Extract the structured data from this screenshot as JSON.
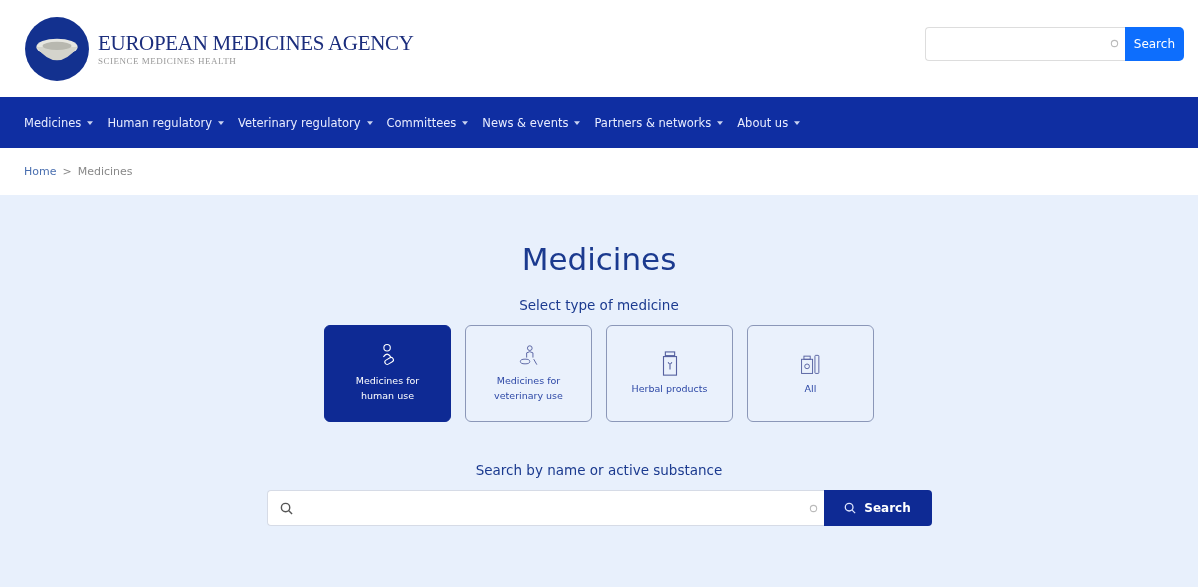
{
  "header": {
    "logo_title": "EUROPEAN MEDICINES AGENCY",
    "logo_tagline": "SCIENCE  MEDICINES  HEALTH",
    "search": {
      "button": "Search"
    }
  },
  "nav": [
    {
      "label": "Medicines",
      "has_menu": true
    },
    {
      "label": "Human regulatory",
      "has_menu": true
    },
    {
      "label": "Veterinary regulatory",
      "has_menu": true
    },
    {
      "label": "Committees",
      "has_menu": true
    },
    {
      "label": "News & events",
      "has_menu": true
    },
    {
      "label": "Partners & networks",
      "has_menu": true
    },
    {
      "label": "About us",
      "has_menu": true
    }
  ],
  "breadcrumb": {
    "items": [
      "Home",
      "Medicines"
    ],
    "separator": ">"
  },
  "page_title": "Medicines",
  "type_heading": "Select type of medicine",
  "types": [
    {
      "label": "Medicines for human use",
      "kind": "human",
      "selected": true
    },
    {
      "label": "Medicines for veterinary use",
      "kind": "veterinary",
      "selected": false
    },
    {
      "label": "Herbal products",
      "kind": "herbal",
      "selected": false
    },
    {
      "label": "All",
      "kind": "all",
      "selected": false
    }
  ],
  "search_heading": "Search by name or active substance",
  "search": {
    "button": "Search"
  }
}
